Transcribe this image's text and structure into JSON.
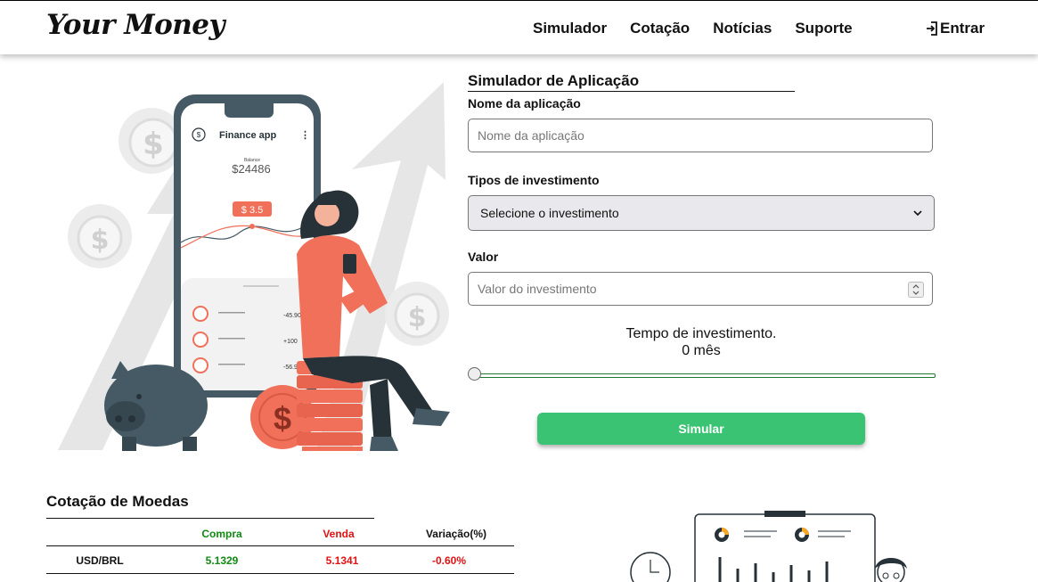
{
  "header": {
    "logo": "Your Money",
    "nav": [
      "Simulador",
      "Cotação",
      "Notícias",
      "Suporte"
    ],
    "login_label": "Entrar"
  },
  "illustration": {
    "app_title": "Finance app",
    "balance_label": "Balance",
    "balance_value": "$24486",
    "badge": "$ 3.5",
    "rows": [
      "-45.90",
      "+100",
      "-56.90"
    ]
  },
  "form": {
    "title": "Simulador de Aplicação",
    "name_label": "Nome da aplicação",
    "name_placeholder": "Nome da aplicação",
    "type_label": "Tipos de investimento",
    "type_selected": "Selecione o investimento",
    "value_label": "Valor",
    "value_placeholder": "Valor do investimento",
    "tempo_label": "Tempo de investimento.",
    "tempo_value": "0 mês",
    "slider_value": 0,
    "submit_label": "Simular"
  },
  "quotes": {
    "title": "Cotação de Moedas",
    "headers": [
      "",
      "Compra",
      "Venda",
      "Variação(%)"
    ],
    "rows": [
      {
        "pair": "USD/BRL",
        "compra": "5.1329",
        "venda": "5.1341",
        "variacao": "-0.60%"
      }
    ]
  },
  "colors": {
    "accent_green": "#3ac373",
    "buy_green": "#118a11",
    "sell_red": "#e01212",
    "illustration_coral": "#f0705a"
  }
}
